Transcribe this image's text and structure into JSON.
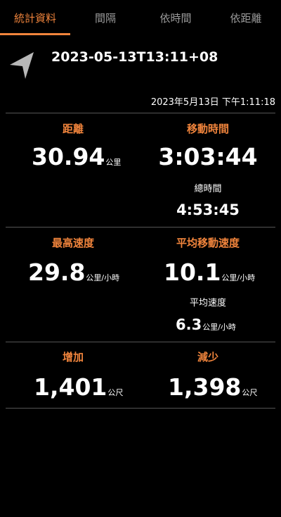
{
  "tabs": [
    {
      "label": "統計資料",
      "active": true
    },
    {
      "label": "間隔",
      "active": false
    },
    {
      "label": "依時間",
      "active": false
    },
    {
      "label": "依距離",
      "active": false
    }
  ],
  "header": {
    "title": "2023-05-13T13:11+08",
    "timestamp": "2023年5月13日 下午1:11:18",
    "icon": "navigation-arrow-icon"
  },
  "stats": {
    "distance": {
      "label": "距離",
      "value": "30.94",
      "unit": "公里"
    },
    "moving_time": {
      "label": "移動時間",
      "value": "3:03:44",
      "total_label": "總時間",
      "total_value": "4:53:45"
    },
    "max_speed": {
      "label": "最高速度",
      "value": "29.8",
      "unit": "公里/小時"
    },
    "avg_moving_speed": {
      "label": "平均移動速度",
      "value": "10.1",
      "unit": "公里/小時",
      "avg_label": "平均速度",
      "avg_value": "6.3",
      "avg_unit": "公里/小時"
    },
    "gain": {
      "label": "增加",
      "value": "1,401",
      "unit": "公尺"
    },
    "loss": {
      "label": "減少",
      "value": "1,398",
      "unit": "公尺"
    }
  },
  "colors": {
    "accent": "#f0843c",
    "background": "#000000",
    "divider": "#555555"
  }
}
